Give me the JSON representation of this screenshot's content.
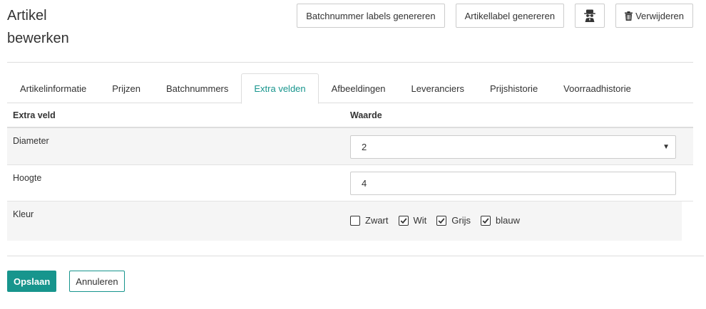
{
  "page": {
    "title_line1": "Artikel",
    "title_line2": "bewerken"
  },
  "toolbar": {
    "batch_labels": "Batchnummer labels genereren",
    "article_label": "Artikellabel genereren",
    "spy_icon": "spy-icon",
    "delete_label": "Verwijderen",
    "delete_icon": "trash-icon"
  },
  "tabs": [
    {
      "label": "Artikelinformatie",
      "active": false
    },
    {
      "label": "Prijzen",
      "active": false
    },
    {
      "label": "Batchnummers",
      "active": false
    },
    {
      "label": "Extra velden",
      "active": true
    },
    {
      "label": "Afbeeldingen",
      "active": false
    },
    {
      "label": "Leveranciers",
      "active": false
    },
    {
      "label": "Prijshistorie",
      "active": false
    },
    {
      "label": "Voorraadhistorie",
      "active": false
    }
  ],
  "grid": {
    "headers": {
      "field": "Extra veld",
      "value": "Waarde"
    },
    "rows": {
      "diameter": {
        "label": "Diameter",
        "value": "2"
      },
      "hoogte": {
        "label": "Hoogte",
        "value": "4"
      },
      "kleur": {
        "label": "Kleur",
        "options": [
          {
            "label": "Zwart",
            "checked": false
          },
          {
            "label": "Wit",
            "checked": true
          },
          {
            "label": "Grijs",
            "checked": true
          },
          {
            "label": "blauw",
            "checked": true
          }
        ]
      }
    }
  },
  "actions": {
    "save": "Opslaan",
    "cancel": "Annuleren"
  },
  "colors": {
    "accent": "#17958d",
    "border": "#dddddd",
    "stripe": "#f5f5f5"
  }
}
